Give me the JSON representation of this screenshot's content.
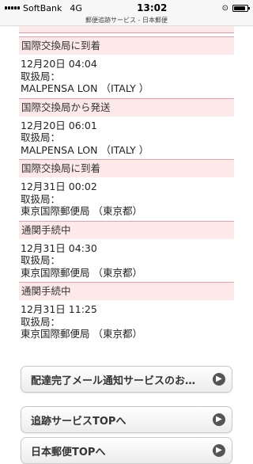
{
  "status_bar": {
    "carrier": "SoftBank",
    "network": "4G",
    "time": "13:02"
  },
  "url_bar": {
    "title": "郵便追跡サービス - 日本郵便"
  },
  "events": [
    {
      "status": "国際交換局に到着",
      "datetime": "12月20日 04:04",
      "office_label": "取扱局：",
      "office": "MALPENSA LON （ITALY ）"
    },
    {
      "status": "国際交換局から発送",
      "datetime": "12月20日 06:01",
      "office_label": "取扱局：",
      "office": "MALPENSA LON （ITALY ）"
    },
    {
      "status": "国際交換局に到着",
      "datetime": "12月31日 00:02",
      "office_label": "取扱局：",
      "office": "東京国際郵便局 （東京都）"
    },
    {
      "status": "通関手続中",
      "datetime": "12月31日 04:30",
      "office_label": "取扱局：",
      "office": "東京国際郵便局 （東京都）"
    },
    {
      "status": "通関手続中",
      "datetime": "12月31日 11:25",
      "office_label": "取扱局：",
      "office": "東京国際郵便局 （東京都）"
    }
  ],
  "buttons": {
    "mail_notify": "配達完了メール通知サービスのお…",
    "tracking_top": "追跡サービスTOPへ",
    "japanpost_top": "日本郵便TOPへ"
  }
}
